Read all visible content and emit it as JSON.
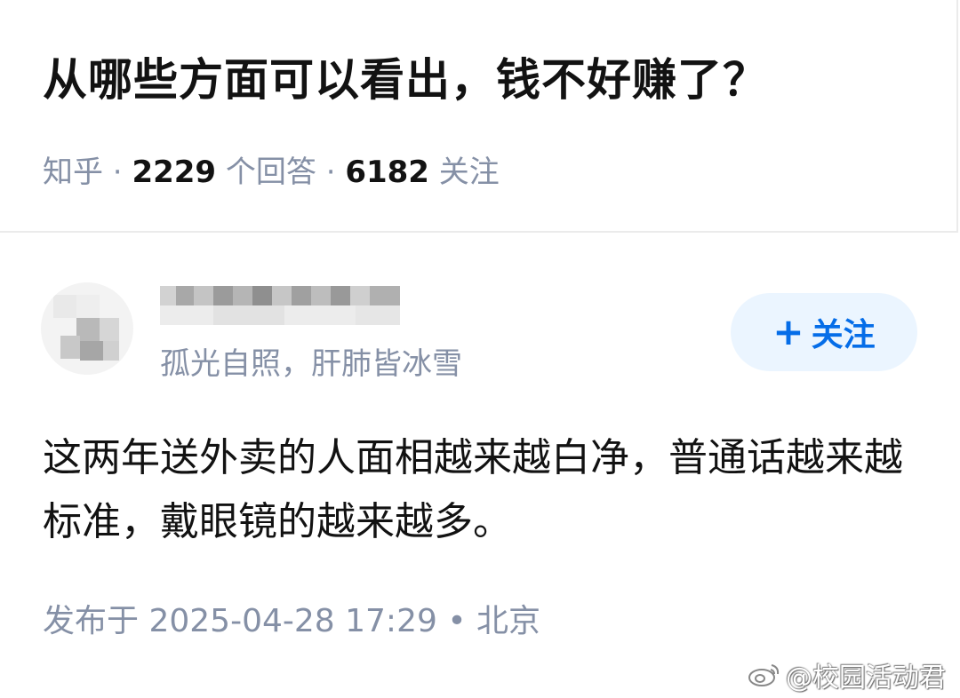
{
  "question": {
    "title": "从哪些方面可以看出，钱不好赚了？",
    "source": "知乎",
    "dot1": " · ",
    "answers_count": "2229",
    "answers_label": " 个回答",
    "dot2": " · ",
    "followers_count": "6182",
    "followers_label": " 关注"
  },
  "author": {
    "bio": "孤光自照，肝肺皆冰雪",
    "follow_plus": "+",
    "follow_label": "关注"
  },
  "answer": {
    "text": "这两年送外卖的人面相越来越白净，普通话越来越标准，戴眼镜的越来越多。",
    "publish_prefix": "发布于",
    "publish_datetime": "2025-04-28 17:29",
    "publish_dot": "•",
    "location": "北京"
  },
  "watermark": {
    "text": "@校园活动君"
  },
  "colors": {
    "title": "#121212",
    "meta": "#8590a6",
    "accent": "#056de8",
    "follow_bg": "#ebf5ff"
  }
}
